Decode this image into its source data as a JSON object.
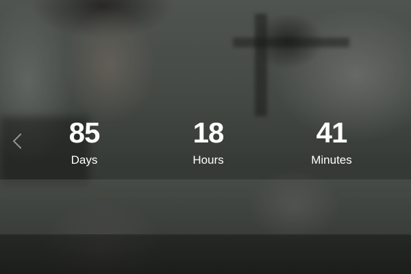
{
  "countdown": {
    "days": {
      "value": "85",
      "label": "Days"
    },
    "hours": {
      "value": "18",
      "label": "Hours"
    },
    "minutes": {
      "value": "41",
      "label": "Minutes"
    }
  },
  "navigation": {
    "prev_icon": "chevron-left-icon"
  },
  "colors": {
    "text": "#ffffff",
    "chevron": "#ebebeb"
  }
}
